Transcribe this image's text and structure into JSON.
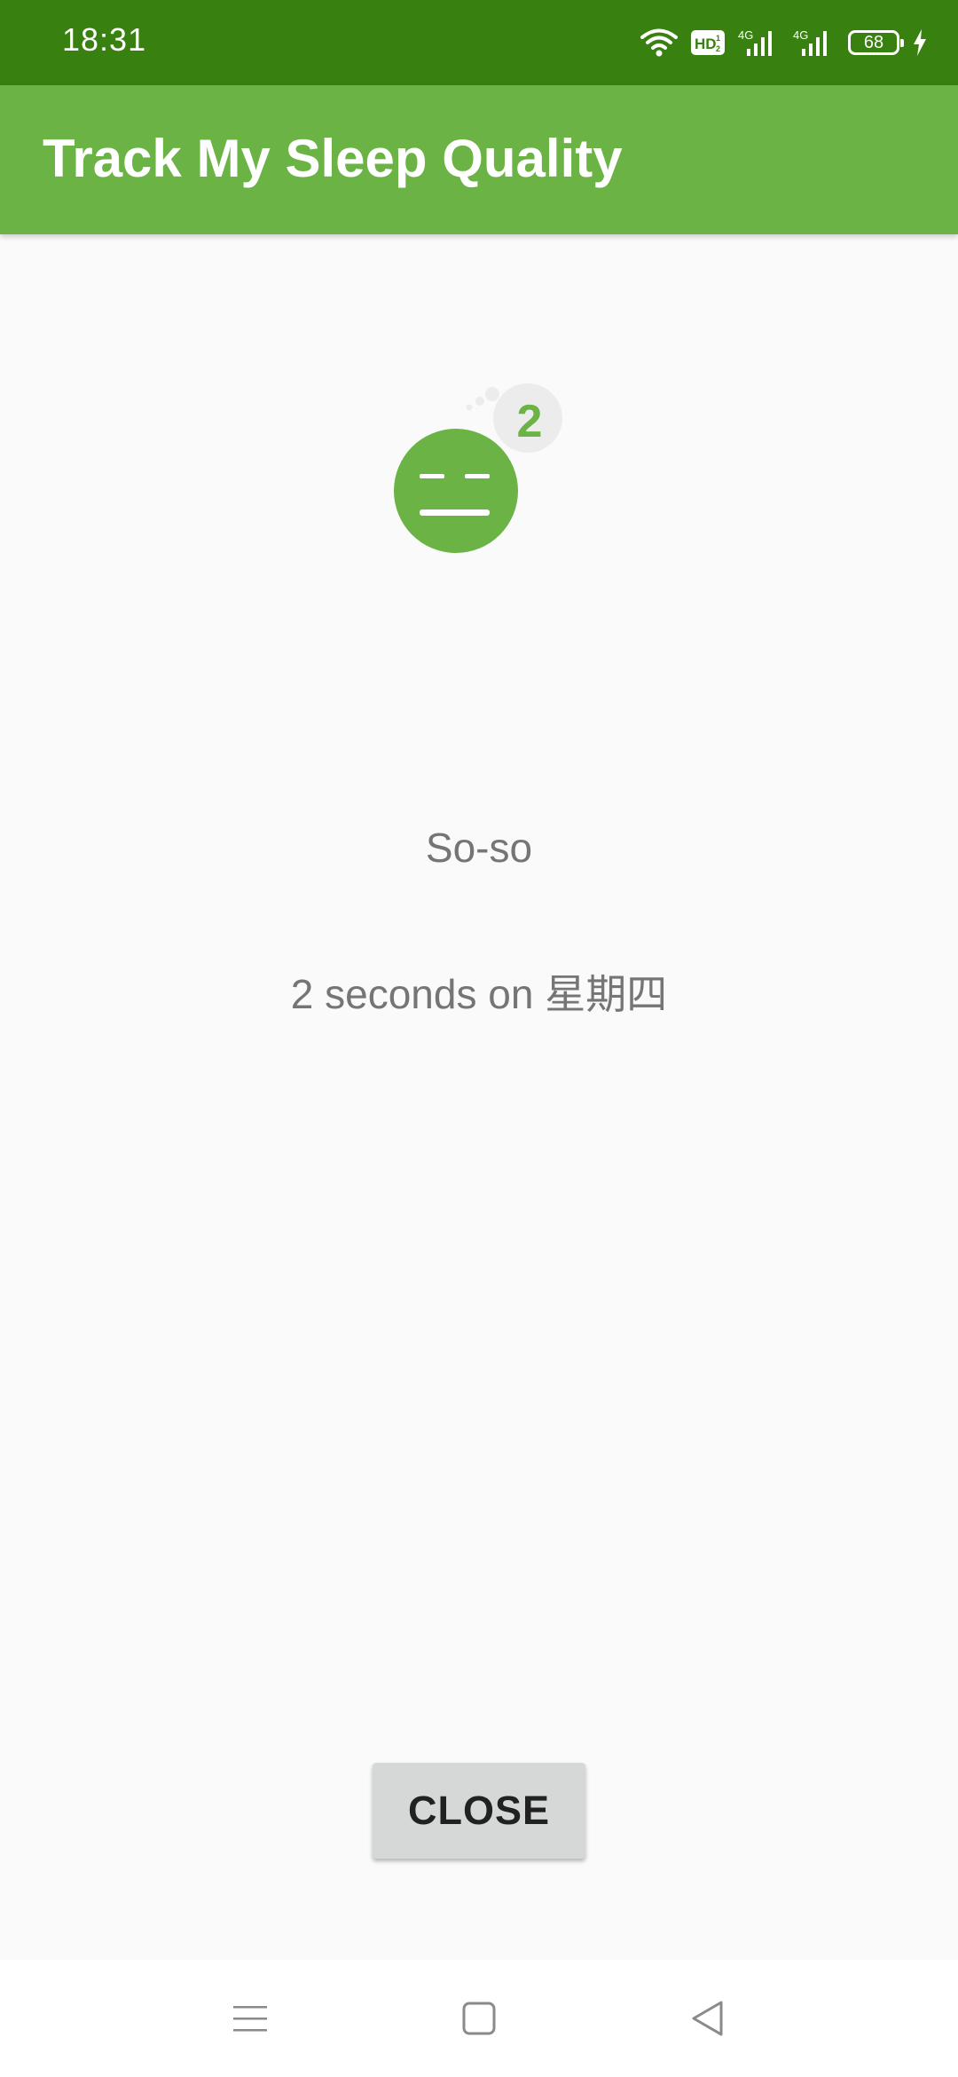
{
  "status_bar": {
    "time": "18:31",
    "battery_level": "68",
    "icons": [
      "wifi-icon",
      "hd-icon",
      "signal-4g-icon",
      "signal-4g-icon",
      "battery-icon",
      "charging-icon"
    ]
  },
  "app_bar": {
    "title": "Track My Sleep Quality"
  },
  "sleep_detail": {
    "icon": "sleep-quality-2-icon",
    "quality_number": "2",
    "quality_label": "So-so",
    "duration_text": "2 seconds on 星期四"
  },
  "actions": {
    "close_label": "CLOSE"
  },
  "nav_bar": {
    "icons": [
      "menu-icon",
      "home-icon",
      "back-icon"
    ]
  },
  "colors": {
    "status_bar": "#38800f",
    "app_bar": "#6ab344",
    "accent": "#6ab344",
    "text_secondary": "#757575",
    "button_bg": "#d6d7d7"
  }
}
